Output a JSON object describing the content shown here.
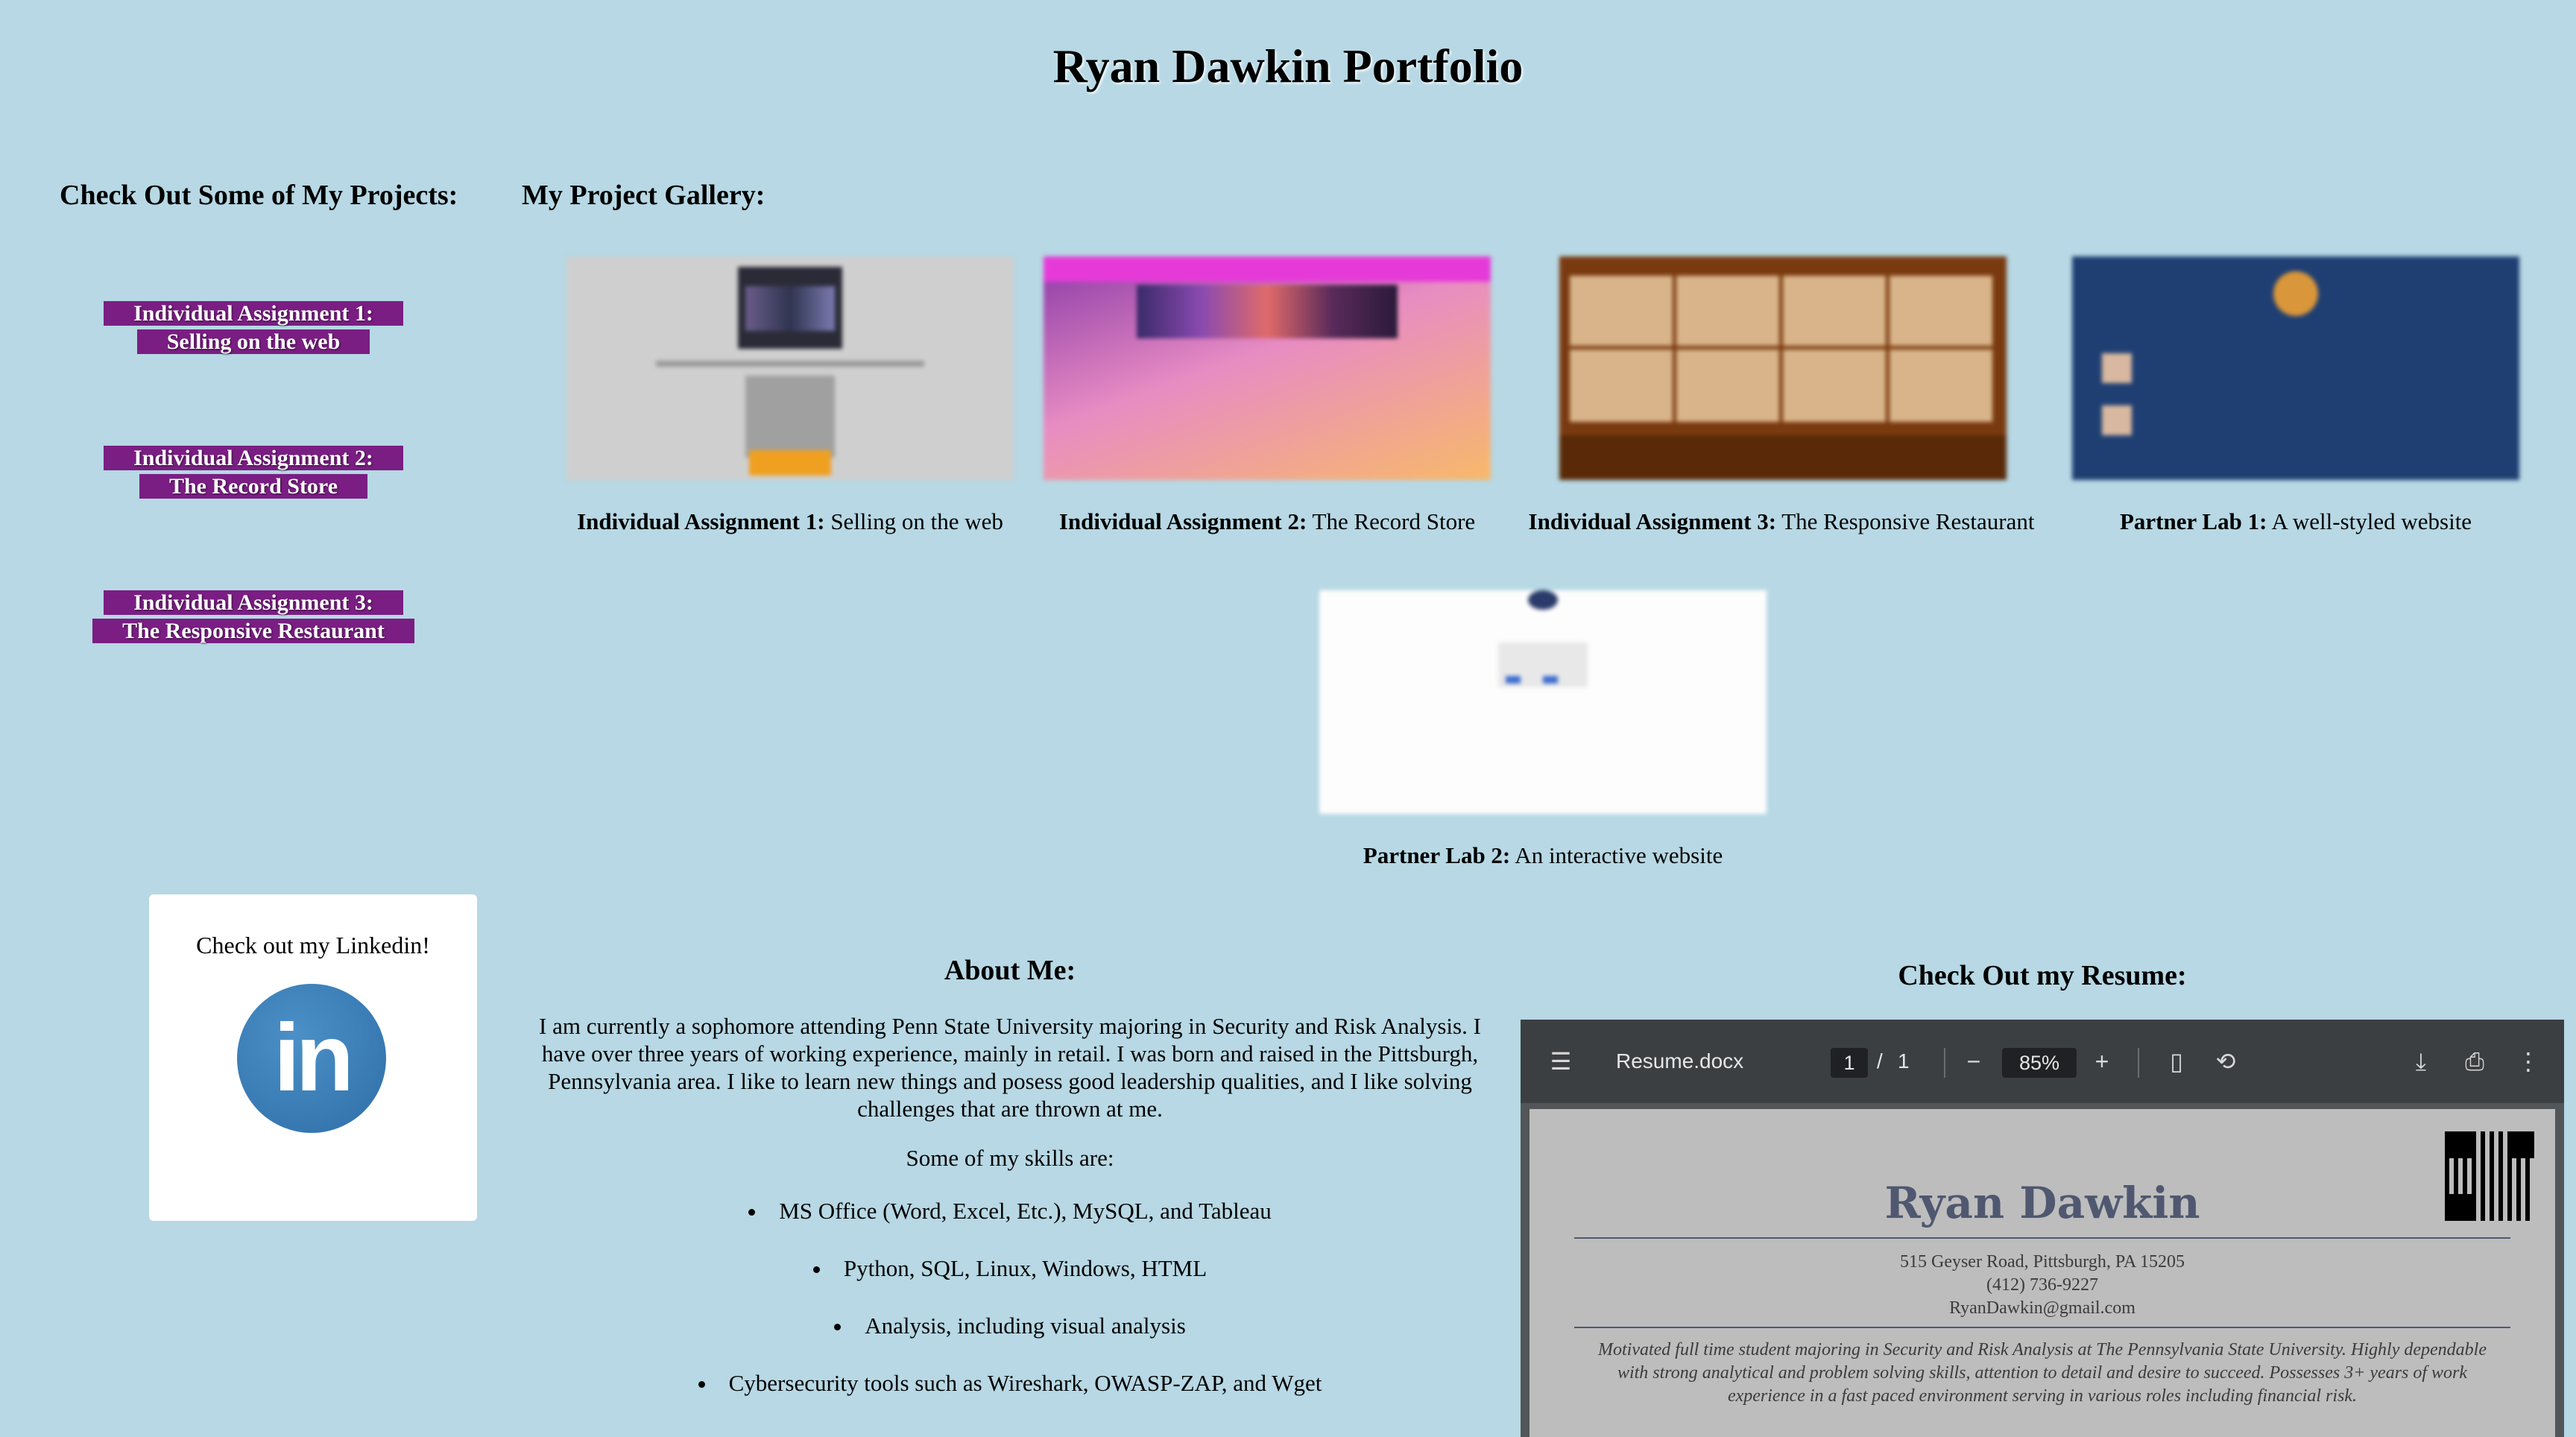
{
  "page": {
    "title": "Ryan Dawkin Portfolio"
  },
  "projects_sidebar": {
    "heading": "Check Out Some of My Projects:",
    "links": [
      {
        "line1": "Individual Assignment 1:",
        "line2": "Selling on the web"
      },
      {
        "line1": "Individual Assignment 2:",
        "line2": "The Record Store"
      },
      {
        "line1": "Individual Assignment 3:",
        "line2": "The Responsive Restaurant"
      }
    ]
  },
  "gallery": {
    "heading": "My Project Gallery:",
    "items": [
      {
        "bold": "Individual Assignment 1:",
        "rest": " Selling on the web"
      },
      {
        "bold": "Individual Assignment 2:",
        "rest": " The Record Store"
      },
      {
        "bold": "Individual Assignment 3:",
        "rest": " The Responsive Restaurant"
      },
      {
        "bold": "Partner Lab 1:",
        "rest": " A well-styled website"
      },
      {
        "bold": "Partner Lab 2:",
        "rest": " An interactive website"
      }
    ]
  },
  "linkedin": {
    "text": "Check out my Linkedin!",
    "logo_text": "in",
    "logo_color": "#3a7bbf"
  },
  "about": {
    "heading": "About Me:",
    "text": "I am currently a sophomore attending Penn State University majoring in Security and Risk Analysis. I have over three years of working experience, mainly in retail. I was born and raised in the Pittsburgh, Pennsylvania area. I like to learn new things and posess good leadership qualities, and I like solving challenges that are thrown at me.",
    "skills_intro": "Some of my skills are:",
    "skills": [
      "MS Office (Word, Excel, Etc.), MySQL, and Tableau",
      "Python, SQL, Linux, Windows, HTML",
      "Analysis, including visual analysis",
      "Cybersecurity tools such as Wireshark, OWASP-ZAP, and Wget"
    ]
  },
  "resume": {
    "heading": "Check Out my Resume:",
    "viewer": {
      "file_name": "Resume.docx",
      "page_current": "1",
      "page_separator": "/",
      "page_total": "1",
      "zoom": "85%"
    },
    "document": {
      "name": "Ryan Dawkin",
      "address": "515 Geyser Road, Pittsburgh, PA 15205",
      "phone": "(412) 736-9227",
      "email": "RyanDawkin@gmail.com",
      "summary": "Motivated full time student majoring in Security and Risk Analysis at The Pennsylvania State University.  Highly dependable with strong analytical and problem solving skills, attention to detail and desire to succeed.   Possesses 3+ years of work experience in a fast paced environment serving in various roles including financial risk."
    }
  },
  "colors": {
    "background": "#b7d8e4",
    "link_background": "#7a1e83",
    "pdf_toolbar": "#3c3f42"
  }
}
